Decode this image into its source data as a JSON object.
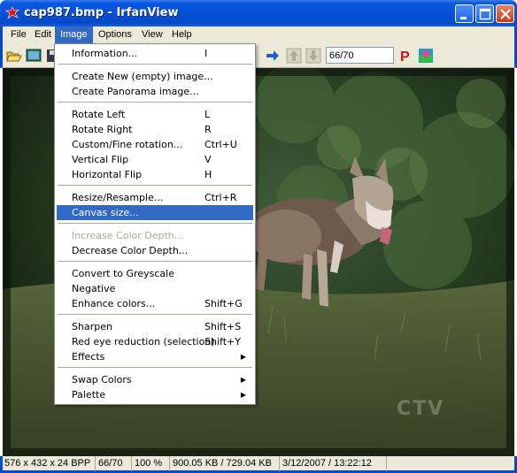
{
  "window": {
    "title": "cap987.bmp - IrfanView",
    "minimize_icon": "minimize-icon",
    "maximize_icon": "maximize-icon",
    "close_icon": "close-icon"
  },
  "menubar": {
    "items": [
      "File",
      "Edit",
      "Image",
      "Options",
      "View",
      "Help"
    ],
    "active": "Image"
  },
  "toolbar": {
    "page_value": "66/70",
    "icons": [
      "open-folder-icon",
      "slideshow-icon",
      "save-icon",
      "next-arrow-icon",
      "up-arrow-icon",
      "down-arrow-icon",
      "print-icon",
      "info-icon"
    ]
  },
  "image_menu": {
    "items": [
      {
        "label": "Information...",
        "shortcut": "I"
      },
      {
        "label": "Create New (empty) image...",
        "shortcut": ""
      },
      {
        "label": "Create Panorama image...",
        "shortcut": ""
      },
      {
        "label": "Rotate Left",
        "shortcut": "L"
      },
      {
        "label": "Rotate Right",
        "shortcut": "R"
      },
      {
        "label": "Custom/Fine rotation...",
        "shortcut": "Ctrl+U"
      },
      {
        "label": "Vertical Flip",
        "shortcut": "V"
      },
      {
        "label": "Horizontal Flip",
        "shortcut": "H"
      },
      {
        "label": "Resize/Resample...",
        "shortcut": "Ctrl+R"
      },
      {
        "label": "Canvas size...",
        "shortcut": ""
      },
      {
        "label": "Increase Color Depth...",
        "shortcut": ""
      },
      {
        "label": "Decrease Color Depth...",
        "shortcut": ""
      },
      {
        "label": "Convert to Greyscale",
        "shortcut": ""
      },
      {
        "label": "Negative",
        "shortcut": ""
      },
      {
        "label": "Enhance colors...",
        "shortcut": "Shift+G"
      },
      {
        "label": "Sharpen",
        "shortcut": "Shift+S"
      },
      {
        "label": "Red eye reduction (selection)",
        "shortcut": "Shift+Y"
      },
      {
        "label": "Effects",
        "shortcut": ""
      },
      {
        "label": "Swap Colors",
        "shortcut": ""
      },
      {
        "label": "Palette",
        "shortcut": ""
      }
    ],
    "highlighted": "Canvas size...",
    "disabled": [
      "Increase Color Depth..."
    ],
    "submenus": [
      "Effects",
      "Swap Colors",
      "Palette"
    ]
  },
  "image": {
    "watermark": "CTV"
  },
  "statusbar": {
    "dimensions": "576 x 432 x 24 BPP",
    "page": "66/70",
    "zoom": "100 %",
    "size": "900.05 KB / 729.04 KB",
    "datetime": "3/12/2007 / 13:22:12"
  },
  "colors": {
    "titlebar": "#0551d8",
    "menu_highlight": "#316ac5",
    "chrome": "#ece9d8"
  }
}
